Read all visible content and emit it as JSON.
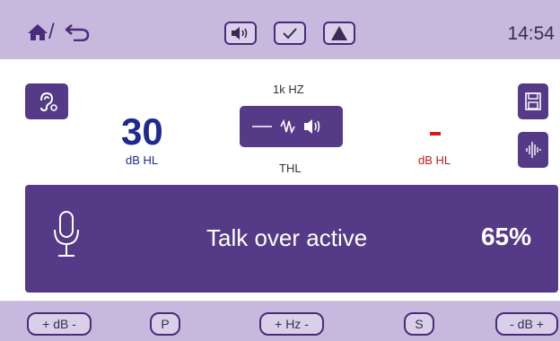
{
  "top_bar": {
    "icons": [
      "home-icon",
      "back-arrow-icon",
      "speaker-icon",
      "check-icon",
      "warning-icon"
    ],
    "divider": "/",
    "time": "14:54"
  },
  "left_channel": {
    "value": "30",
    "unit": "dB HL"
  },
  "center": {
    "frequency": "1k HZ",
    "mode": "THL",
    "stimulus_icons": [
      "tone-line-icon",
      "warble-icon",
      "speaker-icon"
    ]
  },
  "right_channel": {
    "value": "-",
    "unit": "dB HL"
  },
  "side_buttons": {
    "left": "ear-icon",
    "right": [
      "save-icon",
      "waveform-icon"
    ]
  },
  "banner": {
    "icon": "microphone-icon",
    "message": "Talk over active",
    "percent": "65%"
  },
  "bottom_bar": {
    "buttons": [
      "+ dB -",
      "P",
      "+ Hz -",
      "S",
      "- dB +"
    ]
  },
  "colors": {
    "accent": "#553a87",
    "bar": "#c7b9dd",
    "blue_value": "#1e2a8f",
    "red_value": "#c01c1c"
  }
}
